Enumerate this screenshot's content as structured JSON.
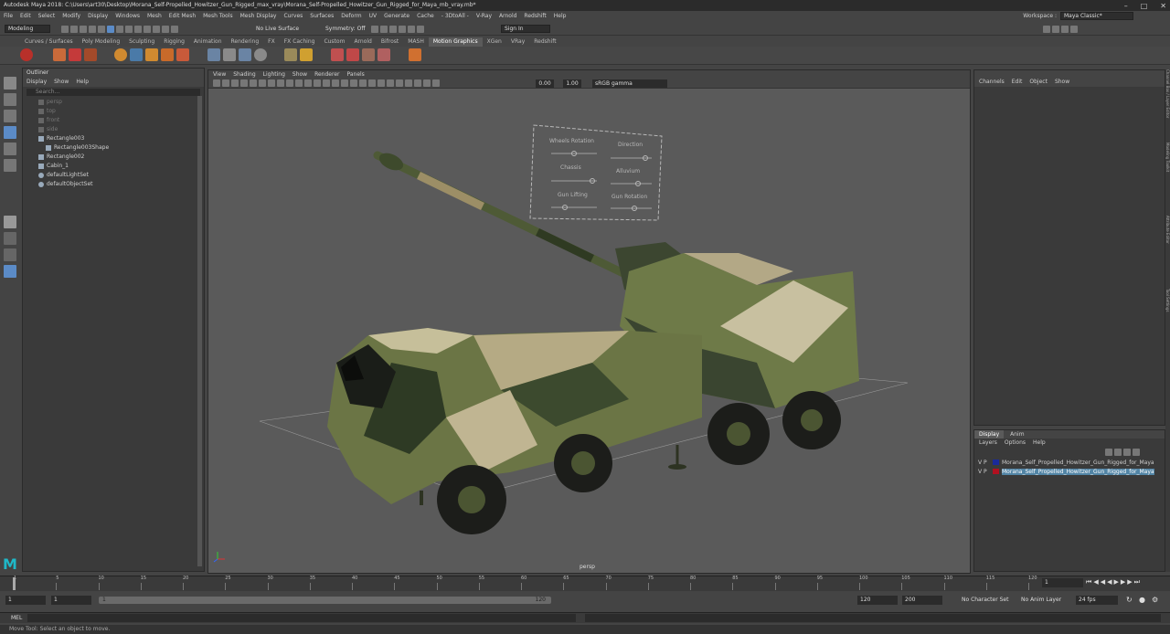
{
  "window": {
    "title": "Autodesk Maya 2018: C:\\Users\\art30\\Desktop\\Morana_Self-Propelled_Howitzer_Gun_Rigged_max_vray\\Morana_Self-Propelled_Howitzer_Gun_Rigged_for_Maya_mb_vray.mb*"
  },
  "menu": [
    "File",
    "Edit",
    "Select",
    "Modify",
    "Display",
    "Windows",
    "Mesh",
    "Edit Mesh",
    "Mesh Tools",
    "Mesh Display",
    "Curves",
    "Surfaces",
    "Deform",
    "UV",
    "Generate",
    "Cache",
    "- 3DtoAll -",
    "V-Ray",
    "Arnold",
    "Redshift",
    "Help"
  ],
  "workspace": {
    "label": "Workspace :",
    "value": "Maya Classic*"
  },
  "status": {
    "mode": "Modeling",
    "live_surface": "No Live Surface",
    "symmetry": "Symmetry: Off",
    "sign_in": "Sign In"
  },
  "shelf_tabs": [
    "Curves / Surfaces",
    "Poly Modeling",
    "Sculpting",
    "Rigging",
    "Animation",
    "Rendering",
    "FX",
    "FX Caching",
    "Custom",
    "Arnold",
    "Bifrost",
    "MASH",
    "Motion Graphics",
    "XGen",
    "VRay",
    "Redshift"
  ],
  "shelf_active": "Motion Graphics",
  "outliner": {
    "title": "Outliner",
    "menu": [
      "Display",
      "Show",
      "Help"
    ],
    "search": "Search...",
    "items": [
      {
        "label": "persp",
        "indent": 0,
        "dim": true
      },
      {
        "label": "top",
        "indent": 0,
        "dim": true
      },
      {
        "label": "front",
        "indent": 0,
        "dim": true
      },
      {
        "label": "side",
        "indent": 0,
        "dim": true
      },
      {
        "label": "Rectangle003",
        "indent": 0,
        "dim": false
      },
      {
        "label": "Rectangle003Shape",
        "indent": 1,
        "dim": false
      },
      {
        "label": "Rectangle002",
        "indent": 0,
        "dim": false
      },
      {
        "label": "Cabin_1",
        "indent": 0,
        "dim": false
      },
      {
        "label": "defaultLightSet",
        "indent": 0,
        "dim": false
      },
      {
        "label": "defaultObjectSet",
        "indent": 0,
        "dim": false
      }
    ]
  },
  "viewport": {
    "menu": [
      "View",
      "Shading",
      "Lighting",
      "Show",
      "Renderer",
      "Panels"
    ],
    "val1": "0.00",
    "val2": "1.00",
    "gamma": "sRGB gamma",
    "camera": "persp"
  },
  "rig_panel": {
    "labels": [
      "Wheels Rotation",
      "Direction",
      "Chassis",
      "Alluvium",
      "Gun Lifting",
      "Gun Rotation"
    ]
  },
  "channelbox": {
    "menu": [
      "Channels",
      "Edit",
      "Object",
      "Show"
    ]
  },
  "layers": {
    "tabs": [
      "Display",
      "Anim"
    ],
    "active": "Display",
    "menu": [
      "Layers",
      "Options",
      "Help"
    ],
    "rows": [
      {
        "v": "V",
        "p": "P",
        "color": "#1a2a9a",
        "name": "Morana_Self_Propelled_Howitzer_Gun_Rigged_for_Maya",
        "selected": false
      },
      {
        "v": "V",
        "p": "P",
        "color": "#b01020",
        "name": "Morana_Self_Propelled_Howitzer_Gun_Rigged_for_Maya",
        "selected": true
      }
    ]
  },
  "side_tabs": [
    "Channel Box / Layer Editor",
    "Modeling Toolkit",
    "Attribute Editor",
    "Tool Settings"
  ],
  "timeline": {
    "ticks": [
      "1",
      "5",
      "10",
      "15",
      "20",
      "25",
      "30",
      "35",
      "40",
      "45",
      "50",
      "55",
      "60",
      "65",
      "70",
      "75",
      "80",
      "85",
      "90",
      "95",
      "100",
      "105",
      "110",
      "115",
      "120"
    ],
    "current": "1"
  },
  "range": {
    "start": "1",
    "start2": "1",
    "slider_start": "1",
    "slider_end": "120",
    "end": "120",
    "end2": "200",
    "character": "No Character Set",
    "anim_layer": "No Anim Layer",
    "fps": "24 fps"
  },
  "mel": {
    "label": "MEL"
  },
  "help": "Move Tool: Select an object to move."
}
